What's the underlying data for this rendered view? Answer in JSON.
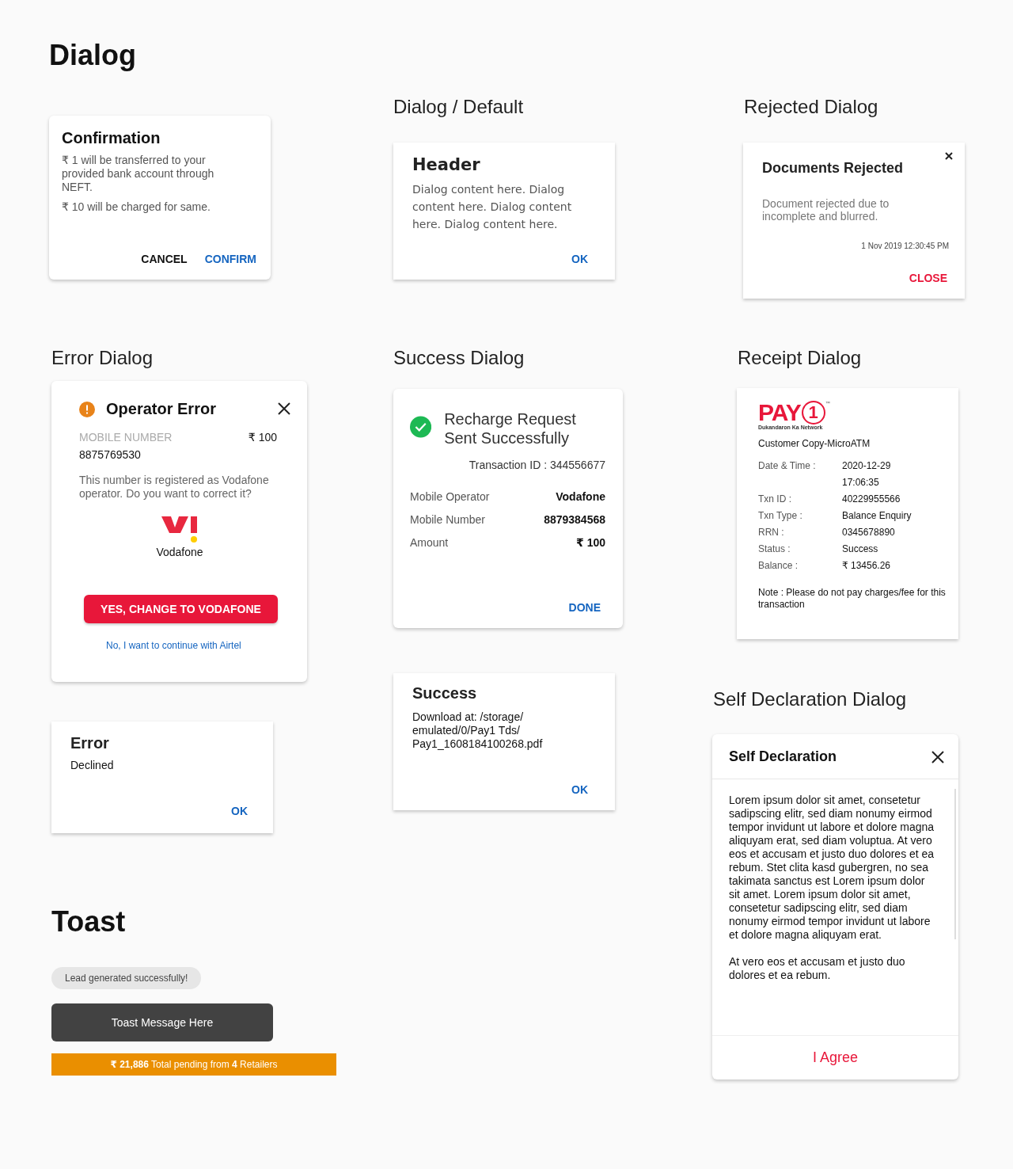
{
  "title": "Dialog",
  "confirmation_dialog": {
    "title": "Confirmation",
    "lines": [
      "₹ 1 will be transferred to your provided bank account through NEFT.",
      "₹ 10 will be charged for same."
    ],
    "actions": [
      {
        "label": "CANCEL",
        "primary": false
      },
      {
        "label": "CONFIRM",
        "primary": true
      }
    ]
  },
  "default_dialog": {
    "section_title": "Dialog / Default",
    "title": "Header",
    "body": "Dialog content here. Dialog content here. Dialog content here. Dialog content here.",
    "action": "OK"
  },
  "rejected_dialog": {
    "section_title": "Rejected Dialog",
    "title": "Documents Rejected",
    "body": "Document rejected due to incomplete and blurred.",
    "timestamp": "1 Nov 2019 12:30:45 PM",
    "action": "CLOSE"
  },
  "error_dialog": {
    "section_title": "Error Dialog",
    "title": "Operator Error",
    "field_label": "MOBILE NUMBER",
    "amount": "₹ 100",
    "number": "8875769530",
    "message": "This number is registered as Vodafone operator. Do you want to correct it?",
    "operator": "Vodafone",
    "primary_action": "YES, CHANGE TO VODAFONE",
    "secondary_action": "No, I want to continue with Airtel"
  },
  "simple_error_dialog": {
    "title": "Error",
    "body": "Declined",
    "action": "OK"
  },
  "success_dialog": {
    "section_title": "Success Dialog",
    "title": "Recharge Request Sent Successfully",
    "transaction": "Transaction ID : 344556677",
    "rows": [
      {
        "label": "Mobile Operator",
        "value": "Vodafone"
      },
      {
        "label": "Mobile Number",
        "value": "8879384568"
      },
      {
        "label": "Amount",
        "value": "₹ 100"
      }
    ],
    "action": "DONE"
  },
  "download_dialog": {
    "title": "Success",
    "lines": [
      "Download at: /storage/",
      "emulated/0/Pay1 Tds/",
      "Pay1_1608184100268.pdf"
    ],
    "action": "OK"
  },
  "receipt_dialog": {
    "section_title": "Receipt Dialog",
    "logo": {
      "text": "PAY",
      "mark": "1",
      "trademark": "™",
      "tagline": "Dukandaron Ka Network"
    },
    "copy_label": "Customer Copy-MicroATM",
    "rows": [
      {
        "label": "Date & Time :",
        "value": [
          "2020-12-29",
          "17:06:35"
        ]
      },
      {
        "label": "Txn ID :",
        "value": [
          "40229955566"
        ]
      },
      {
        "label": "Txn Type :",
        "value": [
          "Balance Enquiry"
        ]
      },
      {
        "label": "RRN :",
        "value": [
          "0345678890"
        ]
      },
      {
        "label": "Status :",
        "value": [
          "Success"
        ]
      },
      {
        "label": "Balance :",
        "value": [
          "₹ 13456.26"
        ]
      }
    ],
    "note": "Note : Please do not pay charges/fee for this transaction"
  },
  "self_declaration_dialog": {
    "section_title": "Self Declaration Dialog",
    "title": "Self Declaration",
    "paragraphs": [
      "Lorem ipsum dolor sit amet, consetetur sadipscing elitr, sed diam nonumy eirmod tempor invidunt ut labore et dolore magna aliquyam erat, sed diam voluptua. At vero eos et accusam et justo duo dolores et ea rebum. Stet clita kasd gubergren, no sea takimata sanctus est Lorem ipsum dolor sit amet. Lorem ipsum dolor sit amet, consetetur sadipscing elitr, sed diam nonumy eirmod tempor invidunt ut labore et dolore magna aliquyam erat.",
      "At vero eos et accusam et justo duo dolores et ea rebum."
    ],
    "action": "I Agree"
  },
  "toast_section": {
    "title": "Toast",
    "toasts": [
      {
        "kind": "pill",
        "text": "Lead generated successfully!"
      },
      {
        "kind": "dark",
        "text": "Toast Message Here"
      },
      {
        "kind": "banner",
        "text": "**₹ 21,886** Total pending from **4** Retailers"
      }
    ]
  }
}
